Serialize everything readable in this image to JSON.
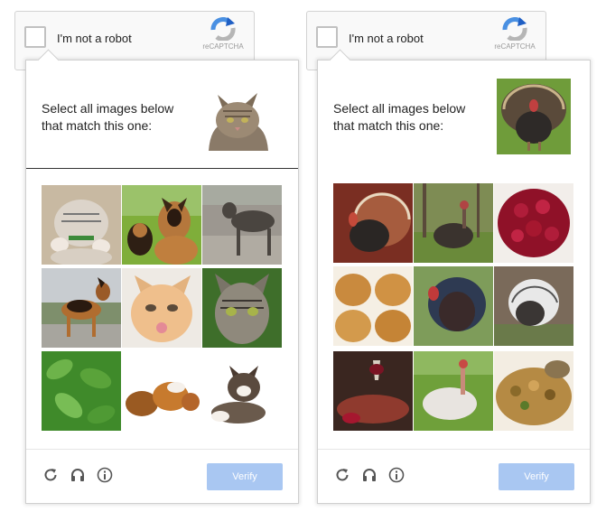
{
  "widgets": [
    {
      "checkbox_label": "I'm not a robot",
      "logo_text": "reCAPTCHA",
      "prompt_line1": "Select all images below",
      "prompt_line2": "that match this one:",
      "sample_image": "cat",
      "tiles": [
        "kitten",
        "dogs",
        "wolf",
        "german-shepherd",
        "kitten-face",
        "tabby-cat",
        "leaves",
        "guinea-pigs",
        "kitten-lying"
      ],
      "verify_label": "Verify"
    },
    {
      "checkbox_label": "I'm not a robot",
      "logo_text": "reCAPTCHA",
      "prompt_line1": "Select all images below",
      "prompt_line2": "that match this one:",
      "sample_image": "turkey",
      "tiles": [
        "turkey",
        "turkey",
        "cranberry-sauce",
        "bread-rolls",
        "turkey",
        "turkey",
        "wine-table",
        "turkey",
        "stuffing"
      ],
      "verify_label": "Verify"
    }
  ],
  "colors": {
    "verify_button": "#a9c7f2",
    "accent_blue": "#4a90e2"
  },
  "icons": [
    "reload-icon",
    "headphones-icon",
    "info-icon"
  ]
}
